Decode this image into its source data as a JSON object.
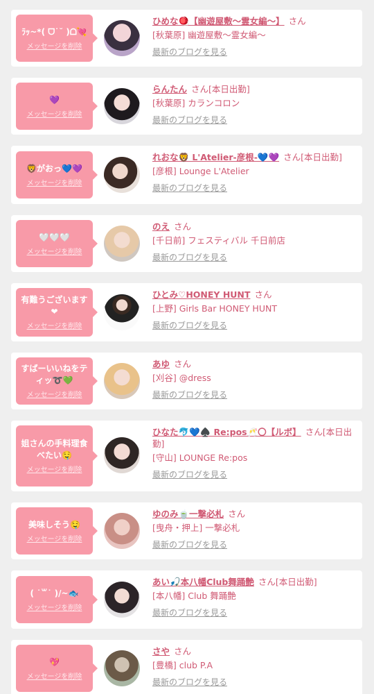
{
  "delete_label": "メッセージを削除",
  "blog_label": "最新のブログを見る",
  "honorific": "さん",
  "colors": {
    "bubble": "#f89aa8",
    "accent": "#d05a74",
    "link_gray": "#9a9a9a"
  },
  "cards": [
    {
      "message": "ﾗｯ~*( ᗜ˙˘ )ᗝ💘",
      "name": "ひめな🪀【幽遊屋敷〜霊女編〜】",
      "status": "",
      "shop": "[秋葉原] 幽遊屋敷〜霊女編〜"
    },
    {
      "message": "💜",
      "name": "らんたん",
      "status": "[本日出勤]",
      "shop": "[秋葉原] カランコロン"
    },
    {
      "message": "🦁がおっ💙💜",
      "name": "れおな🦁 L'Atelier-彦根-💙💜",
      "status": "[本日出勤]",
      "shop": "[彦根] Lounge L'Atelier"
    },
    {
      "message": "🤍🤍🤍",
      "name": "のえ",
      "status": "",
      "shop": "[千日前] フェスティバル 千日前店"
    },
    {
      "message": "有難うございます❤",
      "name": "ひとみ♡HONEY HUNT",
      "status": "",
      "shop": "[上野] Girls Bar HONEY HUNT"
    },
    {
      "message": "すばーいいねをティッ➰💚",
      "name": "あゆ",
      "status": "",
      "shop": "[刈谷] @dress"
    },
    {
      "message": "姐さんの手料理食べたい🤤",
      "name": "ひなた🐬💙♠️ Re:pos🥂〇【ルボ】",
      "status": "[本日出勤]",
      "shop": "[守山] LOUNGE Re:pos"
    },
    {
      "message": "美味しそう🤤",
      "name": "ゆのみ🍵一撃必札",
      "status": "",
      "shop": "[曳舟・押上] 一撃必札"
    },
    {
      "message": "( ˙꒳˙ )/~🐟",
      "name": "あい🎣本八幡Club舞踊艶",
      "status": "[本日出勤]",
      "shop": "[本八幡] Club 舞踊艶"
    },
    {
      "message": "💖",
      "name": "さや",
      "status": "",
      "shop": "[豊橋] club P.A"
    }
  ]
}
